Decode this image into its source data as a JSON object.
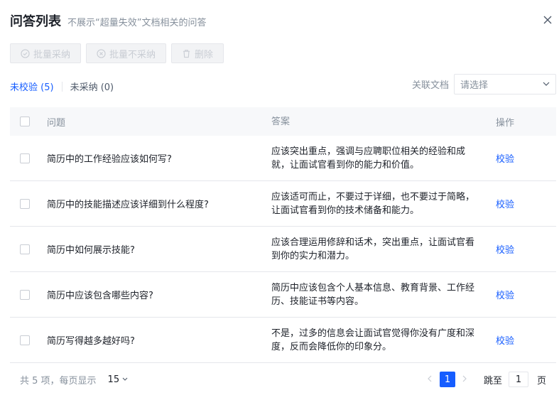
{
  "header": {
    "title": "问答列表",
    "subtitle": "不展示“超量失效”文档相关的问答"
  },
  "toolbar": {
    "batch_accept": "批量采纳",
    "batch_reject": "批量不采纳",
    "delete": "删除"
  },
  "tabs": {
    "unverified": "未校验 (5)",
    "not_accepted": "未采纳 (0)"
  },
  "filter": {
    "label": "关联文档",
    "placeholder": "请选择"
  },
  "table": {
    "headers": {
      "question": "问题",
      "answer": "答案",
      "action": "操作"
    },
    "rows": [
      {
        "question": "简历中的工作经验应该如何写?",
        "answer": "应该突出重点，强调与应聘职位相关的经验和成就，让面试官看到你的能力和价值。",
        "action": "校验"
      },
      {
        "question": "简历中的技能描述应该详细到什么程度?",
        "answer": "应该适可而止，不要过于详细，也不要过于简略，让面试官看到你的技术储备和能力。",
        "action": "校验"
      },
      {
        "question": "简历中如何展示技能?",
        "answer": "应该合理运用修辞和话术，突出重点，让面试官看到你的实力和潜力。",
        "action": "校验"
      },
      {
        "question": "简历中应该包含哪些内容?",
        "answer": "简历中应该包含个人基本信息、教育背景、工作经历、技能证书等内容。",
        "action": "校验"
      },
      {
        "question": "简历写得越多越好吗?",
        "answer": "不是，过多的信息会让面试官觉得你没有广度和深度，反而会降低你的印象分。",
        "action": "校验"
      }
    ]
  },
  "footer": {
    "total": "共 5 项，每页显示",
    "page_size": "15",
    "current_page": "1",
    "jump_label": "跳至",
    "jump_value": "1",
    "page_unit": "页"
  },
  "colors": {
    "accent": "#165dff",
    "muted": "#86909c",
    "border": "#e5e6eb"
  }
}
